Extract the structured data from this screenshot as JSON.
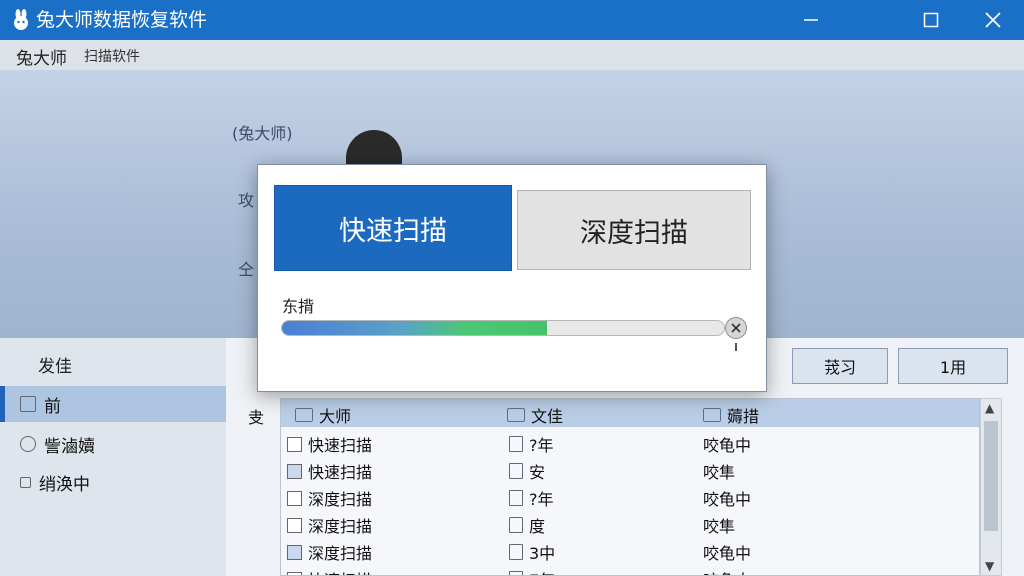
{
  "window": {
    "title": "兔大师数据恢复软件"
  },
  "menubar": {
    "brand": "兔大师",
    "item": "扫描软件"
  },
  "hero": {
    "label1": "(兔大师)",
    "label2": "攻",
    "label3": "仝"
  },
  "sidebar": {
    "header": "发佳",
    "items": [
      {
        "label": "前",
        "icon": "drive-icon"
      },
      {
        "label": "訾滷嬻",
        "icon": "disc-icon"
      },
      {
        "label": "绡涣中",
        "icon": "box-icon"
      }
    ]
  },
  "toolbar": {
    "btn1": "茙习",
    "btn2": "1用"
  },
  "content": {
    "side_label": "叏",
    "columns": [
      "大师",
      "文佳",
      "薅措"
    ],
    "rows": [
      {
        "name": "快速扫描",
        "type": "?年",
        "status": "咬龟中"
      },
      {
        "name": "快速扫描",
        "type": "安",
        "status": "咬隼"
      },
      {
        "name": "深度扫描",
        "type": "?年",
        "status": "咬龟中"
      },
      {
        "name": "深度扫描",
        "type": "度",
        "status": "咬隼"
      },
      {
        "name": "深度扫描",
        "type": "3中",
        "status": "咬龟中"
      },
      {
        "name": "快速扫描",
        "type": "E年",
        "status": "咬龟中"
      }
    ]
  },
  "dialog": {
    "quick_scan": "快速扫描",
    "deep_scan": "深度扫描",
    "progress_label": "东揹",
    "progress_fraction": 0.6
  },
  "colors": {
    "accent": "#1a6fc7",
    "progress_green": "#4cc872"
  }
}
